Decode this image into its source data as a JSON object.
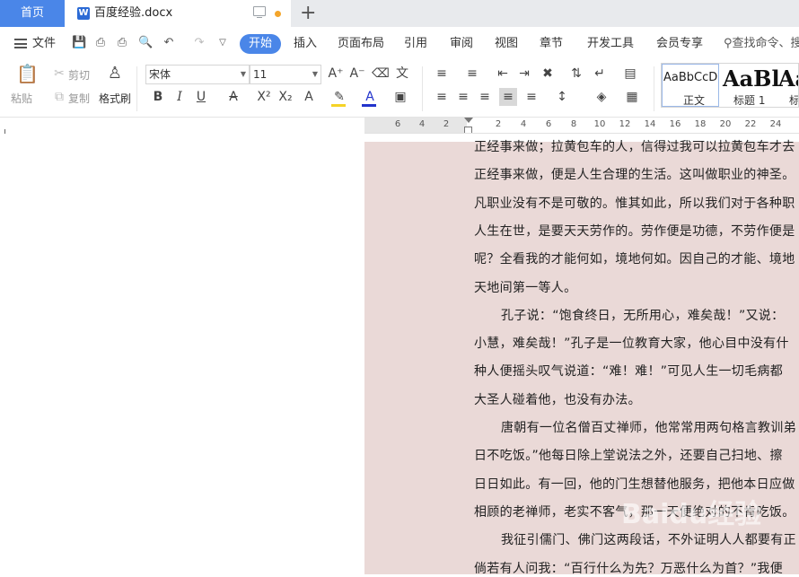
{
  "tabs": {
    "home": "首页",
    "doc_name": "百度经验.docx",
    "doc_icon": "W"
  },
  "menu": {
    "file": "文件",
    "tabs": [
      "开始",
      "插入",
      "页面布局",
      "引用",
      "审阅",
      "视图",
      "章节",
      "开发工具",
      "会员专享"
    ],
    "search": "查找命令、搜"
  },
  "ribbon": {
    "paste": "粘贴",
    "cut": "剪切",
    "copy": "复制",
    "format_painter": "格式刷",
    "font_name": "宋体",
    "font_size": "11",
    "style_normal_sample": "AaBbCcD",
    "style_normal_label": "正文",
    "style_heading_sample": "AaBl",
    "style_heading_label": "标题 1",
    "style_extra_sample": "Aa",
    "style_extra_label": "标"
  },
  "ruler": {
    "numbers": [
      "6",
      "4",
      "2",
      "2",
      "4",
      "6",
      "8",
      "10",
      "12",
      "14",
      "16",
      "18",
      "20",
      "22",
      "24"
    ]
  },
  "document": {
    "lines": [
      {
        "text": "正经事来做；拉黄包车的人，信得过我可以拉黄包车才去",
        "indent": false
      },
      {
        "text": "正经事来做，便是人生合理的生活。这叫做职业的神圣。",
        "indent": false
      },
      {
        "text": "凡职业没有不是可敬的。惟其如此，所以我们对于各种职",
        "indent": false
      },
      {
        "text": "人生在世，是要天天劳作的。劳作便是功德，不劳作便是",
        "indent": false
      },
      {
        "text": "呢？全看我的才能何如，境地何如。因自己的才能、境地",
        "indent": false
      },
      {
        "text": "天地间第一等人。",
        "indent": false
      },
      {
        "text": "孔子说：“饱食终日，无所用心，难矣哉！”又说：",
        "indent": true
      },
      {
        "text": "小慧，难矣哉！”孔子是一位教育大家，他心目中没有什",
        "indent": false
      },
      {
        "text": "种人便摇头叹气说道：“难！难！”可见人生一切毛病都",
        "indent": false
      },
      {
        "text": "大圣人碰着他，也没有办法。",
        "indent": false
      },
      {
        "text": "唐朝有一位名僧百丈禅师，他常常用两句格言教训弟",
        "indent": true
      },
      {
        "text": "日不吃饭。”他每日除上堂说法之外，还要自己扫地、擦",
        "indent": false
      },
      {
        "text": "日日如此。有一回，他的门生想替他服务，把他本日应做",
        "indent": false
      },
      {
        "text": "相顾的老禅师，老实不客气，那一天便绝对的不肯吃饭。",
        "indent": false
      },
      {
        "text": "我征引儒门、佛门这两段话，不外证明人人都要有正",
        "indent": true
      },
      {
        "text": "倘若有人问我：“百行什么为先？万恶什么为首？”我便",
        "indent": false
      }
    ]
  },
  "watermark": "Baidu经验",
  "colors": {
    "accent": "#4a86e8",
    "page_background": "#ead9d7",
    "highlight_yellow": "#f5d327",
    "font_color_blue": "#2233cc"
  }
}
